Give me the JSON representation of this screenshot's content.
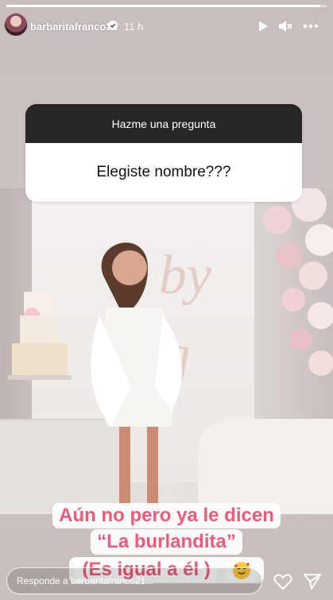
{
  "header": {
    "username": "barbaritafranco21",
    "time": "11 h",
    "progress_fraction": 0.98
  },
  "question_sticker": {
    "title": "Hazme una pregunta",
    "question": "Elegiste nombre???"
  },
  "caption": {
    "line1": "Aún no pero ya le dicen",
    "line2": "“La burlandita”",
    "line3": "(Es igual a él )"
  },
  "footer": {
    "reply_placeholder": "Responde a barbaritafranco21..."
  },
  "icons": {
    "play": "play-icon",
    "mute": "mute-icon",
    "more": "more-icon",
    "like": "heart-icon",
    "share": "send-icon",
    "verified": "verified-badge-icon",
    "emoji": "smiling-face-with-hearts-emoji"
  },
  "colors": {
    "caption_text": "#f05a78",
    "sticker_header": "#262626"
  }
}
